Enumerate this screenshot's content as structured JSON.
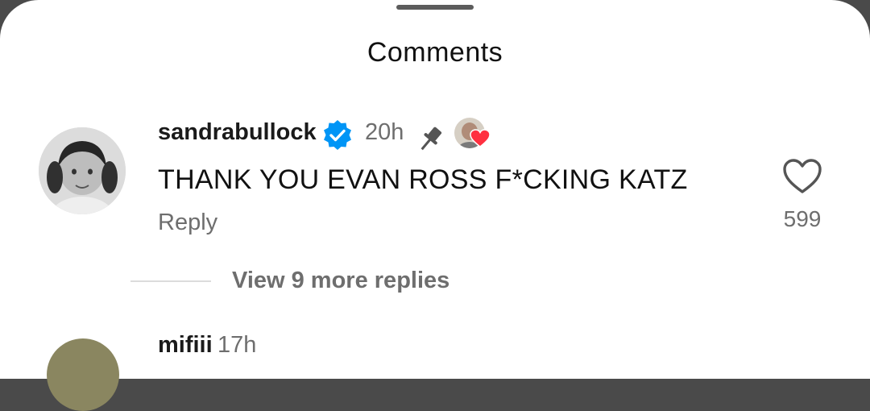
{
  "sheet": {
    "title": "Comments"
  },
  "comment": {
    "username": "sandrabullock",
    "verified": true,
    "time": "20h",
    "pinned": true,
    "liked_by_creator": true,
    "text": "THANK YOU EVAN ROSS F*CKING KATZ",
    "reply_label": "Reply",
    "like_count": "599",
    "view_replies_label": "View 9 more replies"
  },
  "next_comment": {
    "username": "mifiii",
    "time": "17h"
  },
  "colors": {
    "verified_blue": "#0095f6",
    "heart_red": "#ff3040",
    "secondary_text": "#6e6e6e"
  }
}
